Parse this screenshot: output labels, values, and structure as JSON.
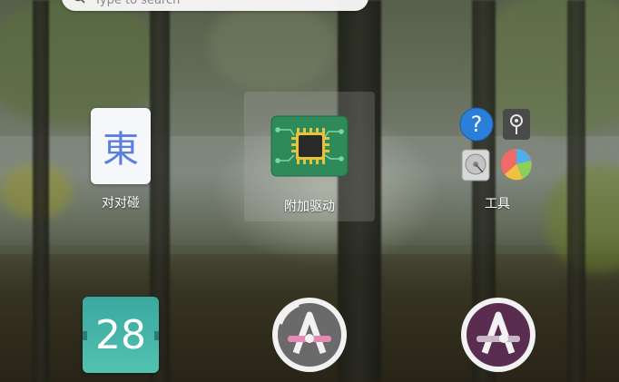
{
  "search": {
    "placeholder": "Type to search"
  },
  "apps": [
    {
      "label": "对对碰",
      "glyph": "東",
      "icon": "kana-icon"
    },
    {
      "label": "附加驱动",
      "icon": "chip-icon"
    },
    {
      "label": "工具",
      "icon": "folder-icon"
    },
    {
      "label": "",
      "glyph": "28",
      "icon": "calendar-icon"
    },
    {
      "label": "",
      "icon": "app-store-icon"
    },
    {
      "label": "",
      "icon": "app-store-icon"
    }
  ],
  "colors": {
    "calendar_teal": "#3aa8a0",
    "store_purple": "#5a2d50",
    "chip_green": "#2f8a5a",
    "help_blue": "#2b7fd8"
  }
}
